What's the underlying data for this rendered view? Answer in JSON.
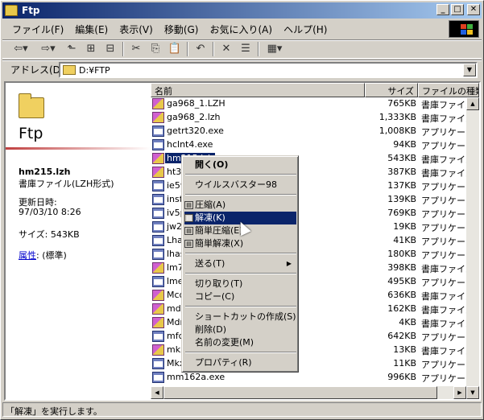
{
  "window": {
    "title": "Ftp"
  },
  "menubar": {
    "items": [
      "ファイル(F)",
      "編集(E)",
      "表示(V)",
      "移動(G)",
      "お気に入り(A)",
      "ヘルプ(H)"
    ]
  },
  "address": {
    "label": "アドレス(D)",
    "value": "D:¥FTP"
  },
  "webpane": {
    "title": "Ftp",
    "filename": "hm215.lzh",
    "filetype": "書庫ファイル(LZH形式)",
    "modified_label": "更新日時:",
    "modified_value": "97/03/10 8:26",
    "size_text": "サイズ: 543KB",
    "attr_link": "属性",
    "attr_value": ": (標準)"
  },
  "columns": {
    "name": "名前",
    "size": "サイズ",
    "type": "ファイルの種類"
  },
  "files": [
    {
      "name": "ga968_1.LZH",
      "size": "765KB",
      "type": "書庫ファイル",
      "icon": "lzh"
    },
    {
      "name": "ga968_2.lzh",
      "size": "1,333KB",
      "type": "書庫ファイル",
      "icon": "lzh"
    },
    {
      "name": "getrt320.exe",
      "size": "1,008KB",
      "type": "アプリケーション",
      "icon": "exe"
    },
    {
      "name": "hclnt4.exe",
      "size": "94KB",
      "type": "アプリケーション",
      "icon": "exe"
    },
    {
      "name": "hm215.lzh",
      "size": "543KB",
      "type": "書庫ファイル",
      "icon": "lzh",
      "selected": true
    },
    {
      "name": "ht31",
      "size": "387KB",
      "type": "書庫ファイル",
      "icon": "lzh"
    },
    {
      "name": "ie5w",
      "size": "137KB",
      "type": "アプリケーション",
      "icon": "exe"
    },
    {
      "name": "inst",
      "size": "139KB",
      "type": "アプリケーション",
      "icon": "exe"
    },
    {
      "name": "iv5p",
      "size": "769KB",
      "type": "アプリケーション",
      "icon": "exe"
    },
    {
      "name": "jw2u",
      "size": "19KB",
      "type": "アプリケーション",
      "icon": "exe"
    },
    {
      "name": "Lha2",
      "size": "41KB",
      "type": "アプリケーション",
      "icon": "exe"
    },
    {
      "name": "lhas",
      "size": "180KB",
      "type": "アプリケーション",
      "icon": "exe"
    },
    {
      "name": "lm78",
      "size": "398KB",
      "type": "書庫ファイル",
      "icon": "lzh"
    },
    {
      "name": "lmel",
      "size": "495KB",
      "type": "アプリケーション",
      "icon": "exe"
    },
    {
      "name": "Mcd",
      "size": "636KB",
      "type": "書庫ファイル",
      "icon": "lzh"
    },
    {
      "name": "mdm",
      "size": "162KB",
      "type": "書庫ファイル",
      "icon": "lzh"
    },
    {
      "name": "Mdm",
      "size": "4KB",
      "type": "書庫ファイル",
      "icon": "lzh"
    },
    {
      "name": "mfc4",
      "size": "642KB",
      "type": "アプリケーション",
      "icon": "exe"
    },
    {
      "name": "mkx",
      "size": "13KB",
      "type": "書庫ファイル",
      "icon": "lzh"
    },
    {
      "name": "Mkx",
      "size": "11KB",
      "type": "アプリケーション",
      "icon": "exe"
    },
    {
      "name": "mm162a.exe",
      "size": "996KB",
      "type": "アプリケーション",
      "icon": "exe"
    }
  ],
  "context_menu": {
    "open": "開く(O)",
    "virus": "ウイルスバスター98",
    "compress": "圧縮(A)",
    "extract": "解凍(K)",
    "easy_compress": "簡単圧縮(E)",
    "easy_extract": "簡単解凍(X)",
    "send_to": "送る(T)",
    "cut": "切り取り(T)",
    "copy": "コピー(C)",
    "shortcut": "ショートカットの作成(S)",
    "delete": "削除(D)",
    "rename": "名前の変更(M)",
    "properties": "プロパティ(R)"
  },
  "status": {
    "text": "「解凍」を実行します。"
  },
  "colors": {
    "selection": "#0a246a",
    "titlebar_start": "#0a246a",
    "titlebar_end": "#a6caf0"
  }
}
